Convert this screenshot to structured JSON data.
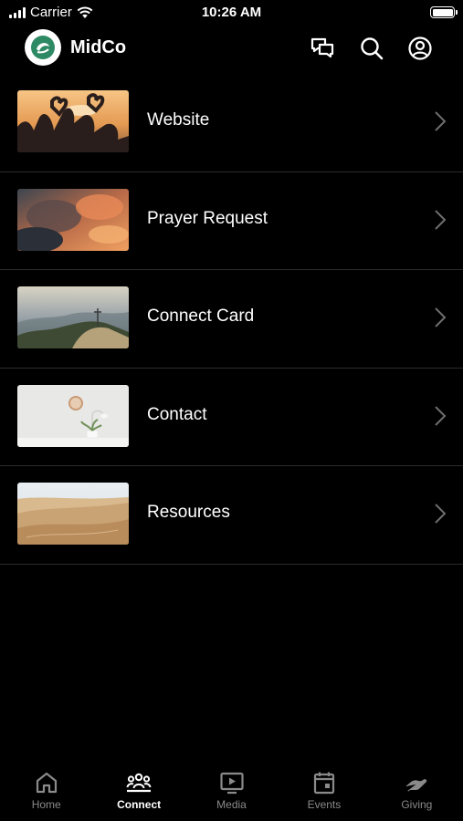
{
  "status_bar": {
    "carrier": "Carrier",
    "time": "10:26 AM"
  },
  "header": {
    "app_name": "MidCo",
    "icons": [
      "chat-icon",
      "search-icon",
      "profile-icon"
    ]
  },
  "menu": {
    "items": [
      {
        "label": "Website",
        "thumbnail": "hands-heart-sunset-photo"
      },
      {
        "label": "Prayer Request",
        "thumbnail": "sunset-clouds-photo"
      },
      {
        "label": "Connect Card",
        "thumbnail": "mountain-cross-photo"
      },
      {
        "label": "Contact",
        "thumbnail": "white-wall-clock-plant-photo"
      },
      {
        "label": "Resources",
        "thumbnail": "desert-dunes-photo"
      }
    ]
  },
  "tab_bar": {
    "tabs": [
      {
        "label": "Home",
        "icon": "home-icon",
        "active": false
      },
      {
        "label": "Connect",
        "icon": "people-icon",
        "active": true
      },
      {
        "label": "Media",
        "icon": "media-play-icon",
        "active": false
      },
      {
        "label": "Events",
        "icon": "calendar-icon",
        "active": false
      },
      {
        "label": "Giving",
        "icon": "giving-hand-icon",
        "active": false
      }
    ]
  },
  "colors": {
    "background": "#000000",
    "text": "#ffffff",
    "tab_inactive": "#8a8a8a",
    "divider": "#2b2b2b",
    "logo_accent": "#2e8a64"
  }
}
